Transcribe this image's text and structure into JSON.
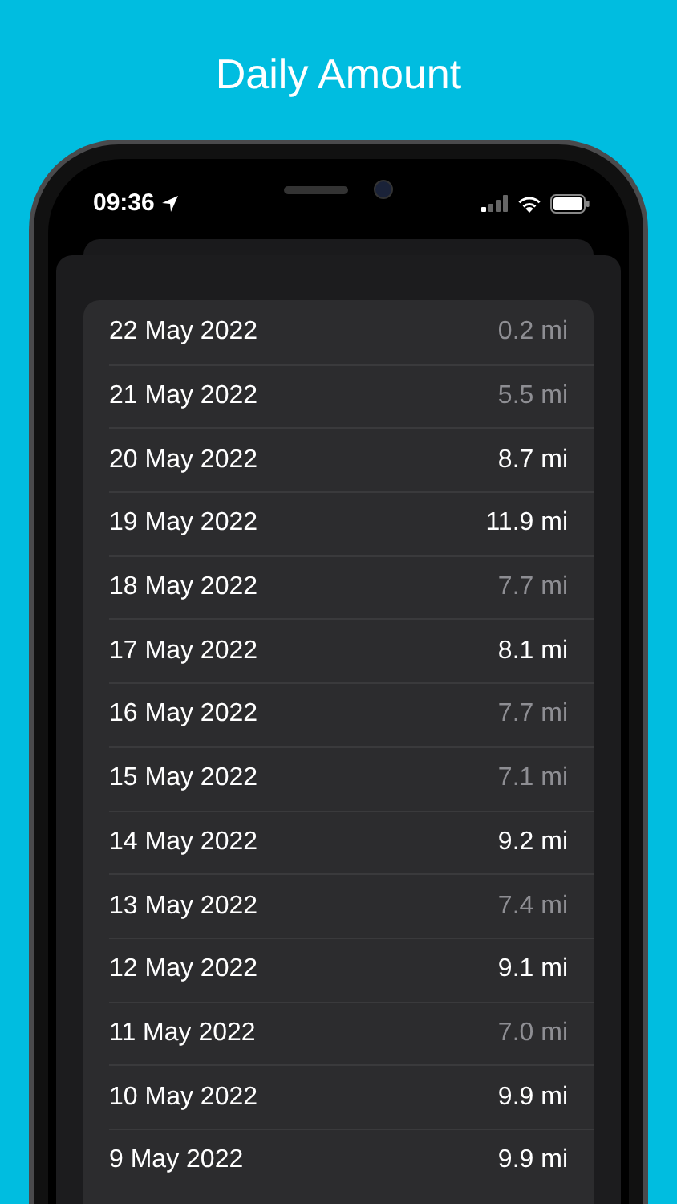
{
  "headline": "Daily Amount",
  "status_bar": {
    "time": "09:36"
  },
  "rows": [
    {
      "date": "22 May 2022",
      "distance": "0.2 mi",
      "goal_met": false
    },
    {
      "date": "21 May 2022",
      "distance": "5.5 mi",
      "goal_met": false
    },
    {
      "date": "20 May 2022",
      "distance": "8.7 mi",
      "goal_met": true
    },
    {
      "date": "19 May 2022",
      "distance": "11.9 mi",
      "goal_met": true
    },
    {
      "date": "18 May 2022",
      "distance": "7.7 mi",
      "goal_met": false
    },
    {
      "date": "17 May 2022",
      "distance": "8.1 mi",
      "goal_met": true
    },
    {
      "date": "16 May 2022",
      "distance": "7.7 mi",
      "goal_met": false
    },
    {
      "date": "15 May 2022",
      "distance": "7.1 mi",
      "goal_met": false
    },
    {
      "date": "14 May 2022",
      "distance": "9.2 mi",
      "goal_met": true
    },
    {
      "date": "13 May 2022",
      "distance": "7.4 mi",
      "goal_met": false
    },
    {
      "date": "12 May 2022",
      "distance": "9.1 mi",
      "goal_met": true
    },
    {
      "date": "11 May 2022",
      "distance": "7.0 mi",
      "goal_met": false
    },
    {
      "date": "10 May 2022",
      "distance": "9.9 mi",
      "goal_met": true
    },
    {
      "date": "9 May 2022",
      "distance": "9.9 mi",
      "goal_met": true
    }
  ]
}
